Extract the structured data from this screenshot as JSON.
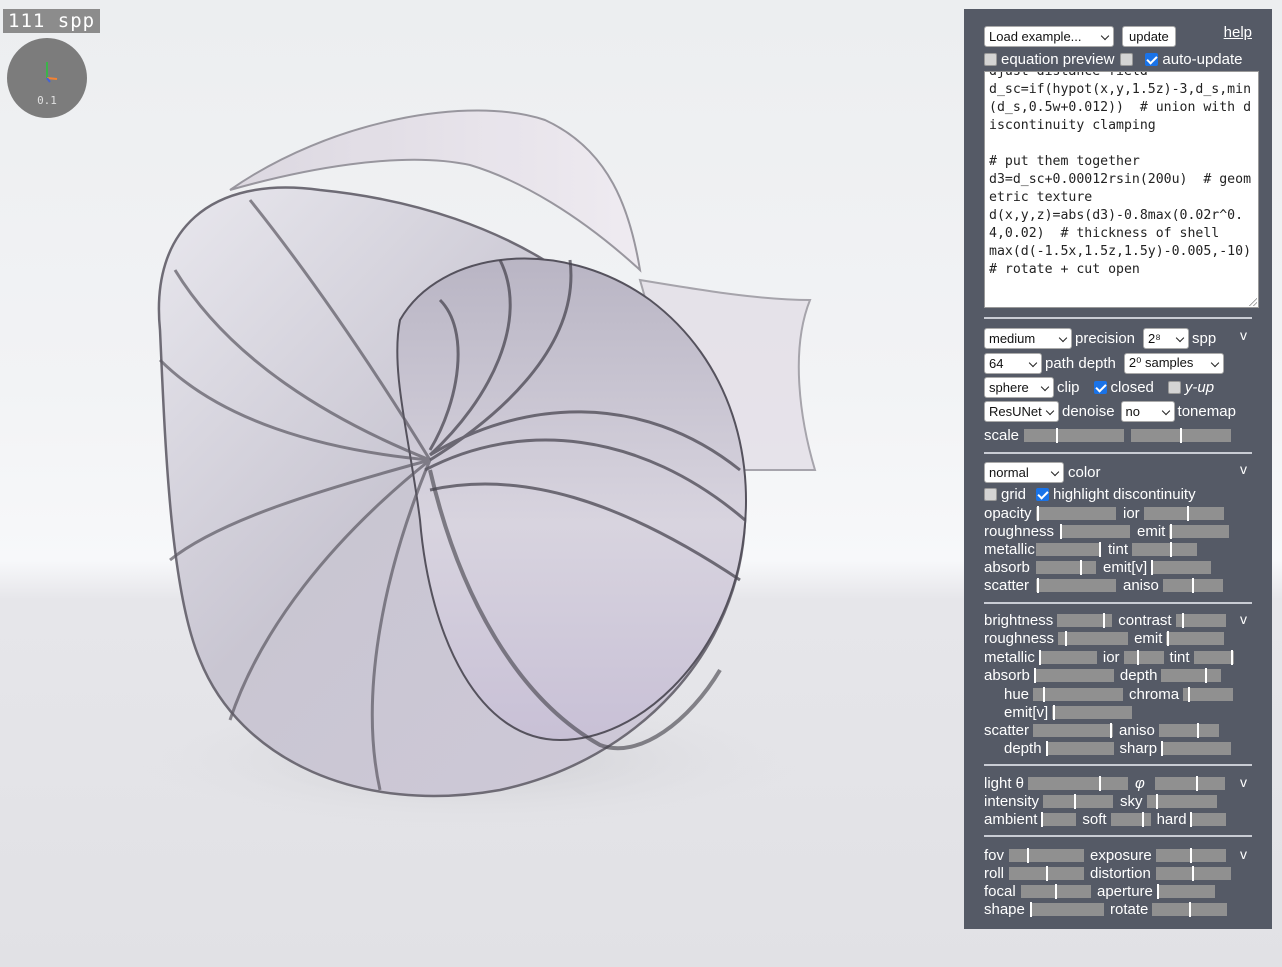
{
  "viewport": {
    "spp_badge": "111 spp",
    "axis_scale": "0.1"
  },
  "panel": {
    "load_example": "Load example...",
    "update": "update",
    "help": "help",
    "equation_preview": "equation preview",
    "auto_update": "auto-update",
    "equation_preview_checked": false,
    "unnamed_checked": false,
    "auto_update_checked": true,
    "code": "djust distance field\nd_sc=if(hypot(x,y,1.5z)-3,d_s,min(d_s,0.5w+0.012))  # union with discontinuity clamping\n\n# put them together\nd3=d_sc+0.00012rsin(200u)  # geometric texture\nd(x,y,z)=abs(d3)-0.8max(0.02r^0.4,0.02)  # thickness of shell\nmax(d(-1.5x,1.5z,1.5y)-0.005,-10)  # rotate + cut open"
  },
  "render_section": {
    "precision": "medium",
    "precision_label": "precision",
    "spp": "2⁸",
    "spp_label": "spp",
    "toggle": "v",
    "path_depth": "64",
    "path_depth_label": "path depth",
    "samples": "2⁰ samples",
    "clip": "sphere",
    "clip_label": "clip",
    "closed": "closed",
    "closed_checked": true,
    "yup": "y-up",
    "yup_checked": false,
    "denoise": "ResUNet",
    "denoise_label": "denoise",
    "tonemap": "no",
    "tonemap_label": "tonemap",
    "scale_label": "scale",
    "scale_values": [
      0.33,
      0.5
    ]
  },
  "color_section": {
    "mode": "normal",
    "mode_label": "color",
    "toggle": "v",
    "grid": "grid",
    "grid_checked": false,
    "highlight": "highlight discontinuity",
    "highlight_checked": true,
    "rows": [
      {
        "a": "opacity",
        "av": 0.02,
        "b": "ior",
        "bv": 0.55
      },
      {
        "a": "roughness",
        "av": 0.02,
        "b": "emit",
        "bv": 0.02
      },
      {
        "a": "metallic",
        "av": 0.98,
        "b": "tint",
        "bv": 0.6
      },
      {
        "a": "absorb",
        "av": 0.75,
        "b": "emit[v]",
        "bv": 0.02
      },
      {
        "a": "scatter",
        "av": 0.02,
        "b": "aniso",
        "bv": 0.5
      }
    ]
  },
  "material_section": {
    "toggle": "v",
    "rows": [
      [
        {
          "k": "brightness",
          "v": 0.85
        },
        {
          "k": "contrast",
          "v": 0.15
        }
      ],
      [
        {
          "k": "roughness",
          "v": 0.12
        },
        {
          "k": "emit",
          "v": 0.02
        }
      ],
      [
        {
          "k": "metallic",
          "v": 0.02
        },
        {
          "k": "ior",
          "v": 0.35
        },
        {
          "k": "tint",
          "v": 0.95
        }
      ],
      [
        {
          "k": "absorb",
          "v": 0.02
        },
        {
          "k": "depth",
          "v": 0.75
        }
      ],
      [
        {
          "k": "hue",
          "v": 0.12
        },
        {
          "k": "chroma",
          "v": 0.12
        }
      ],
      [
        {
          "k": "emit[v]",
          "v": 0.02
        }
      ],
      [
        {
          "k": "scatter",
          "v": 0.98
        },
        {
          "k": "aniso",
          "v": 0.65
        }
      ],
      [
        {
          "k": "depth",
          "v": 0.02
        },
        {
          "k": "sharp",
          "v": 0.02
        }
      ]
    ]
  },
  "light_section": {
    "toggle": "v",
    "theta": "light θ",
    "phi": "φ",
    "intensity": "intensity",
    "sky": "sky",
    "ambient": "ambient",
    "soft": "soft",
    "hard": "hard",
    "values": {
      "theta": 0.72,
      "phi": 0.6,
      "intensity": 0.45,
      "sky": 0.15,
      "ambient": 0.02,
      "soft": 0.8,
      "hard": 0.02
    }
  },
  "camera_section": {
    "toggle": "v",
    "fov": "fov",
    "exposure": "exposure",
    "roll": "roll",
    "distortion": "distortion",
    "focal": "focal",
    "aperture": "aperture",
    "shape": "shape",
    "rotate": "rotate",
    "values": {
      "fov": 0.25,
      "exposure": 0.5,
      "roll": 0.5,
      "distortion": 0.5,
      "focal": 0.5,
      "aperture": 0.02,
      "shape": 0.02,
      "rotate": 0.5
    }
  }
}
